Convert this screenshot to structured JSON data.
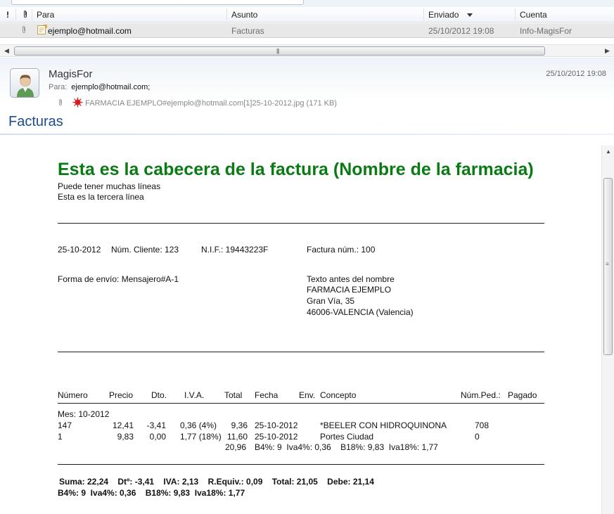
{
  "list": {
    "columns": {
      "importance": "!",
      "attachment": "0",
      "from": "Para",
      "subject": "Asunto",
      "sent": "Enviado",
      "account": "Cuenta"
    },
    "rows": [
      {
        "from": "ejemplo@hotmail.com",
        "subject": "Facturas",
        "sent": "25/10/2012 19:08",
        "account": "Info-MagisFor"
      }
    ]
  },
  "message": {
    "sender": "MagisFor",
    "date": "25/10/2012 19:08",
    "to_label": "Para:",
    "to_value": "ejemplo@hotmail.com;",
    "attachment": "FARMACIA EJEMPLO#ejemplo@hotmail.com[1]25-10-2012.jpg (171 KB)",
    "subject": "Facturas"
  },
  "invoice": {
    "title": "Esta es la cabecera de la factura (Nombre de la farmacia)",
    "subtitle_lines": [
      "Puede tener muchas líneas",
      "Esta es la tercera línea"
    ],
    "date": "25-10-2012",
    "client": "Núm. Cliente: 123",
    "nif": "N.I.F.: 19443223F",
    "invoice_number": "Factura núm.: 100",
    "shipping": "Forma de envío: Mensajero#A-1",
    "address_lines": [
      "Texto antes del nombre",
      "FARMACIA EJEMPLO",
      "Gran Vía, 35",
      "46006-VALENCIA  (Valencia)"
    ],
    "table_headers": {
      "numero": "Número",
      "precio": "Precio",
      "dto": "Dto.",
      "iva": "I.V.A.",
      "total": "Total",
      "fecha": "Fecha",
      "env": "Env.",
      "concepto": "Concepto",
      "numped": "Núm.Ped.:",
      "pagado": "Pagado"
    },
    "month": "Mes: 10-2012",
    "rows": [
      {
        "numero": "147",
        "precio": "12,41",
        "dto": "-3,41",
        "iva": "0,36 (4%)",
        "total": "9,36",
        "fecha": "25-10-2012",
        "concepto": "*BEELER CON HIDROQUINONA",
        "numped": "708"
      },
      {
        "numero": "1",
        "precio": "9,83",
        "dto": "0,00",
        "iva": "1,77 (18%)",
        "total": "11,60",
        "fecha": "25-10-2012",
        "concepto": "Portes Ciudad",
        "numped": "0"
      }
    ],
    "subtotal_line": {
      "total": "20,96",
      "breakdown": "B4%: 9  Iva4%: 0,36    B18%: 9,83  Iva18%: 1,77"
    },
    "summary_line1": "Suma: 22,24    Dtº: -3,41    IVA: 2,13    R.Equiv.: 0,09    Total: 21,05    Debe: 21,14",
    "summary_line2": "B4%: 9  Iva4%: 0,36    B18%: 9,83  Iva18%: 1,77"
  }
}
